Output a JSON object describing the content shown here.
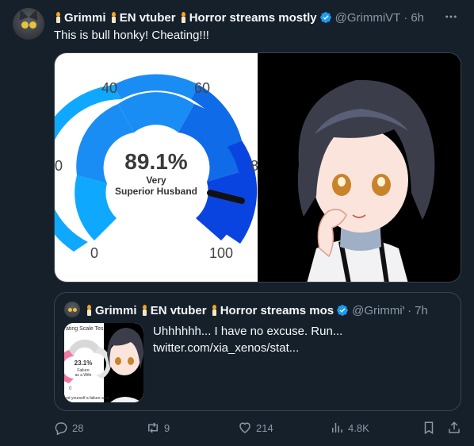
{
  "author": {
    "name": "Grimmi 🕯 EN vtuber 🕯 Horror streams mostly",
    "name_parts": [
      "Grimmi",
      "EN vtuber",
      "Horror streams mostly"
    ],
    "handle": "@GrimmiVT",
    "separator": "·",
    "time": "6h",
    "verified": true,
    "avatar_icon": "cat-avatar-icon"
  },
  "tweet_text": "This is bull honky! Cheating!!!",
  "media": {
    "gauge": {
      "percent_label": "89.1%",
      "value": 89.1,
      "caption_line1": "Very",
      "caption_line2": "Superior Husband",
      "ticks": [
        "0",
        "40",
        "60",
        "100"
      ],
      "edge_left": "0",
      "edge_right": "8",
      "colors": [
        "#0fa8ff",
        "#1a8df5",
        "#0f6be8",
        "#0a44e0"
      ]
    },
    "art_description_icon": "anime-character-thinking-icon"
  },
  "quote": {
    "author": {
      "name_parts": [
        "Grimmi",
        "EN vtuber",
        "Horror streams mos"
      ],
      "handle": "@GrimmiV",
      "separator": "·",
      "time": "7h",
      "verified": true
    },
    "text_line1": "Uhhhhhh... I have no excuse. Run...",
    "text_line2": "twitter.com/xia_xenos/stat...",
    "thumb": {
      "header": "ating Scale Tes",
      "percent_label": "23.1%",
      "caption_line1": "Failure",
      "caption_line2": "as a Wife",
      "footer": "nd yourself a failure as a",
      "tick_left": "0"
    }
  },
  "actions": {
    "replies": "28",
    "retweets": "9",
    "likes": "214",
    "views": "4.8K"
  },
  "colors": {
    "background": "#15202b",
    "text": "#f7f9f9",
    "muted": "#8b98a5",
    "verified": "#1d9bf0",
    "border": "#38444d"
  }
}
